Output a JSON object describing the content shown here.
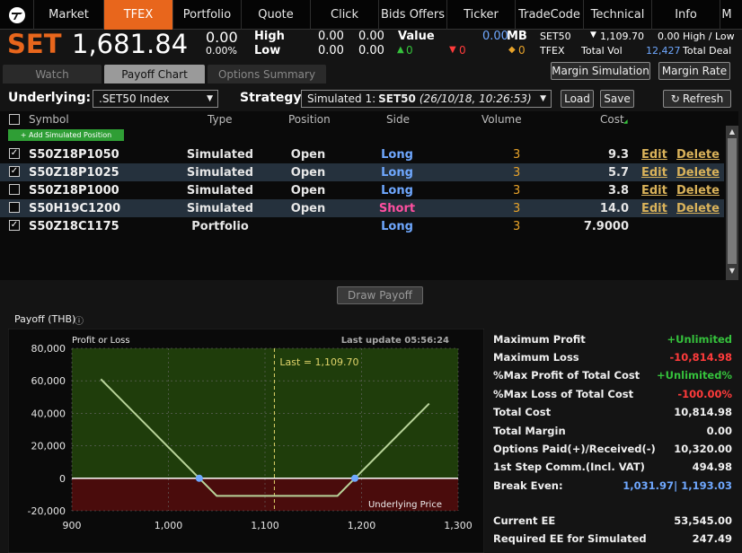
{
  "nav": {
    "tabs": [
      "Market",
      "TFEX",
      "Portfolio",
      "Quote",
      "Click",
      "Bids Offers",
      "Ticker",
      "TradeCode",
      "Technical",
      "Info",
      "M"
    ],
    "active": "TFEX"
  },
  "quote": {
    "index": "SET",
    "value": "1,681.84",
    "change": "0.00",
    "change_pct": "0.00%",
    "high_label": "High",
    "low_label": "Low",
    "high": "0.00",
    "low": "0.00",
    "high2": "0.00",
    "low2": "0.00",
    "value_label": "Value",
    "value_amt": "0.00",
    "value_unit": "MB",
    "up_count": "0",
    "down_count": "0",
    "unch_count": "0",
    "tfex_index": "SET50",
    "tfex_label": "TFEX",
    "tfex_last": "1,109.70",
    "tfex_change": "0.00",
    "hl_label": "High / Low",
    "vol_label": "Total Vol",
    "total_vol": "12,427",
    "deal_label": "Total Deal"
  },
  "subtabs": [
    "Watch",
    "Payoff Chart",
    "Options Summary"
  ],
  "buttons": {
    "margin_sim": "Margin Simulation",
    "margin_rate": "Margin Rate",
    "load": "Load",
    "save": "Save",
    "refresh": "Refresh",
    "draw_payoff": "Draw Payoff",
    "add_sim": "+ Add Simulated Position"
  },
  "controls": {
    "underlying_label": "Underlying:",
    "underlying_value": ".SET50 Index",
    "strategy_label": "Strategy:",
    "strategy_value": "Simulated 1: ",
    "strategy_bold": "SET50",
    "strategy_italic": "(26/10/18, 10:26:53)"
  },
  "table": {
    "headers": [
      "Symbol",
      "Type",
      "Position",
      "Side",
      "Volume",
      "Cost"
    ],
    "rows": [
      {
        "checked": true,
        "symbol": "S50Z18P1050",
        "type": "Simulated",
        "position": "Open",
        "side": "Long",
        "volume": "3",
        "cost": "9.3",
        "edit": "Edit",
        "delete": "Delete"
      },
      {
        "checked": true,
        "symbol": "S50Z18P1025",
        "type": "Simulated",
        "position": "Open",
        "side": "Long",
        "volume": "3",
        "cost": "5.7",
        "edit": "Edit",
        "delete": "Delete"
      },
      {
        "checked": false,
        "symbol": "S50Z18P1000",
        "type": "Simulated",
        "position": "Open",
        "side": "Long",
        "volume": "3",
        "cost": "3.8",
        "edit": "Edit",
        "delete": "Delete"
      },
      {
        "checked": false,
        "symbol": "S50H19C1200",
        "type": "Simulated",
        "position": "Open",
        "side": "Short",
        "volume": "3",
        "cost": "14.0",
        "edit": "Edit",
        "delete": "Delete"
      },
      {
        "checked": true,
        "symbol": "S50Z18C1175",
        "type": "Portfolio",
        "position": "",
        "side": "Long",
        "volume": "3",
        "cost": "7.9000",
        "edit": "",
        "delete": ""
      }
    ]
  },
  "payoff_title": "Payoff (THB)",
  "colors": {
    "accent": "#e8661c",
    "profit": "#1f3d0b",
    "loss": "#4a0c0c",
    "line": "#b9d49a",
    "long": "#6fa8ff",
    "short": "#ff4fa0",
    "green": "#35c23c",
    "red": "#ff3b3b"
  },
  "chart_data": {
    "type": "line",
    "title": "Profit or Loss",
    "xlabel": "Underlying Price",
    "ylabel": "",
    "last_update": "Last update 05:56:24",
    "last_label": "Last = 1,109.70",
    "last_value": 1109.7,
    "xlim": [
      900,
      1300
    ],
    "ylim": [
      -20000,
      80000
    ],
    "x_ticks": [
      "900",
      "1,000",
      "1,100",
      "1,200",
      "1,300"
    ],
    "x_tick_values": [
      900,
      1000,
      1100,
      1200,
      1300
    ],
    "y_ticks": [
      "80,000",
      "60,000",
      "40,000",
      "20,000",
      "0",
      "-20,000"
    ],
    "y_tick_values": [
      80000,
      60000,
      40000,
      20000,
      0,
      -20000
    ],
    "series": [
      {
        "values_x": [
          930,
          1031.97,
          1050,
          1175,
          1193.03,
          1270
        ],
        "values_y": [
          61000,
          0,
          -10815,
          -10815,
          0,
          46000
        ]
      }
    ],
    "break_even_points": [
      1031.97,
      1193.03
    ]
  },
  "stats": [
    {
      "label": "Maximum Profit",
      "value": "+Unlimited",
      "color": "#35c23c"
    },
    {
      "label": "Maximum Loss",
      "value": "-10,814.98",
      "color": "#ff3b3b"
    },
    {
      "label": "%Max Profit of Total Cost",
      "value": "+Unlimited%",
      "color": "#35c23c"
    },
    {
      "label": "%Max Loss of Total Cost",
      "value": "-100.00%",
      "color": "#ff3b3b"
    },
    {
      "label": "Total Cost",
      "value": "10,814.98",
      "color": "#f0f0f0"
    },
    {
      "label": "Total Margin",
      "value": "0.00",
      "color": "#f0f0f0"
    },
    {
      "label": "Options Paid(+)/Received(-)",
      "value": "10,320.00",
      "color": "#f0f0f0"
    },
    {
      "label": "1st Step Comm.(Incl. VAT)",
      "value": "494.98",
      "color": "#f0f0f0"
    },
    {
      "label": "Break Even:",
      "value": "1,031.97| 1,193.03",
      "color": "#6fa8ff"
    },
    {
      "label": "Current EE",
      "value": "53,545.00",
      "color": "#f0f0f0"
    },
    {
      "label": "Required EE for Simulated",
      "value": "247.49",
      "color": "#f0f0f0"
    }
  ]
}
